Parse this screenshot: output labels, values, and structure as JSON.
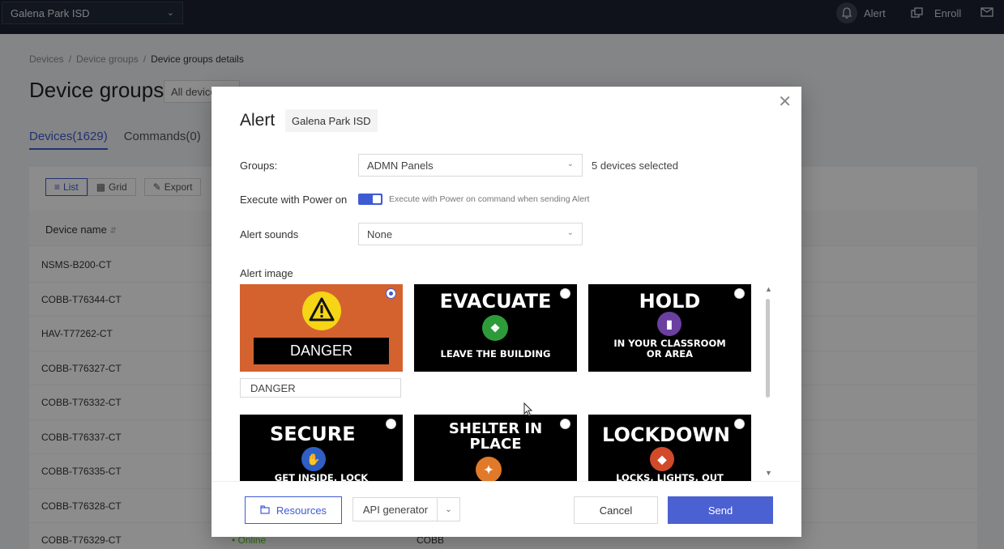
{
  "topbar": {
    "org": "Galena Park ISD",
    "alert_label": "Alert",
    "enroll_label": "Enroll"
  },
  "page": {
    "breadcrumb": [
      "Devices",
      "Device groups",
      "Device groups details"
    ],
    "title": "Device groups:",
    "group_select": "All devices",
    "tabs": [
      "Devices(1629)",
      "Commands(0)"
    ],
    "toolbar": {
      "list": "List",
      "grid": "Grid",
      "export": "Export"
    },
    "column_device_name": "Device name",
    "rows": [
      {
        "name": "NSMS-B200-CT",
        "status": "",
        "group": ""
      },
      {
        "name": "COBB-T76344-CT",
        "status": "",
        "group": ""
      },
      {
        "name": "HAV-T77262-CT",
        "status": "",
        "group": ""
      },
      {
        "name": "COBB-T76327-CT",
        "status": "",
        "group": ""
      },
      {
        "name": "COBB-T76332-CT",
        "status": "",
        "group": ""
      },
      {
        "name": "COBB-T76337-CT",
        "status": "",
        "group": ""
      },
      {
        "name": "COBB-T76335-CT",
        "status": "",
        "group": ""
      },
      {
        "name": "COBB-T76328-CT",
        "status": "",
        "group": ""
      },
      {
        "name": "COBB-T76329-CT",
        "status": "• Online",
        "group": "COBB"
      }
    ]
  },
  "modal": {
    "title": "Alert",
    "org_badge": "Galena Park ISD",
    "groups_label": "Groups:",
    "groups_value": "ADMN Panels",
    "devices_selected": "5 devices selected",
    "power_label": "Execute with Power on",
    "power_on": true,
    "power_hint": "Execute with Power on command when sending Alert",
    "sounds_label": "Alert sounds",
    "sounds_value": "None",
    "image_label": "Alert image",
    "images": [
      {
        "head": "",
        "banner": "DANGER",
        "sub": "",
        "bg": "#d4622f",
        "selected": true,
        "icon": "warning-icon"
      },
      {
        "head": "EVACUATE",
        "sub": "LEAVE THE BUILDING",
        "bg": "#000000",
        "dot": "#2e9b3a",
        "selected": false,
        "icon": "people-icon"
      },
      {
        "head": "HOLD",
        "sub": "IN YOUR CLASSROOM OR AREA",
        "bg": "#000000",
        "dot": "#6a3fa0",
        "selected": false,
        "icon": "door-icon"
      },
      {
        "head": "SECURE",
        "sub": "GET INSIDE. LOCK",
        "bg": "#000000",
        "dot": "#2f5fc4",
        "selected": false,
        "icon": "hands-icon"
      },
      {
        "head": "SHELTER IN PLACE",
        "sub": "",
        "bg": "#000000",
        "dot": "#e07a2a",
        "selected": false,
        "icon": "person-icon"
      },
      {
        "head": "LOCKDOWN",
        "sub": "LOCKS, LIGHTS, OUT",
        "bg": "#000000",
        "dot": "#d24a2a",
        "selected": false,
        "icon": "lock-icon"
      }
    ],
    "danger_text": "DANGER",
    "buttons": {
      "resources": "Resources",
      "api": "API generator",
      "cancel": "Cancel",
      "send": "Send"
    }
  },
  "colors": {
    "primary": "#3f5bd3",
    "topbar": "#1c2230"
  }
}
